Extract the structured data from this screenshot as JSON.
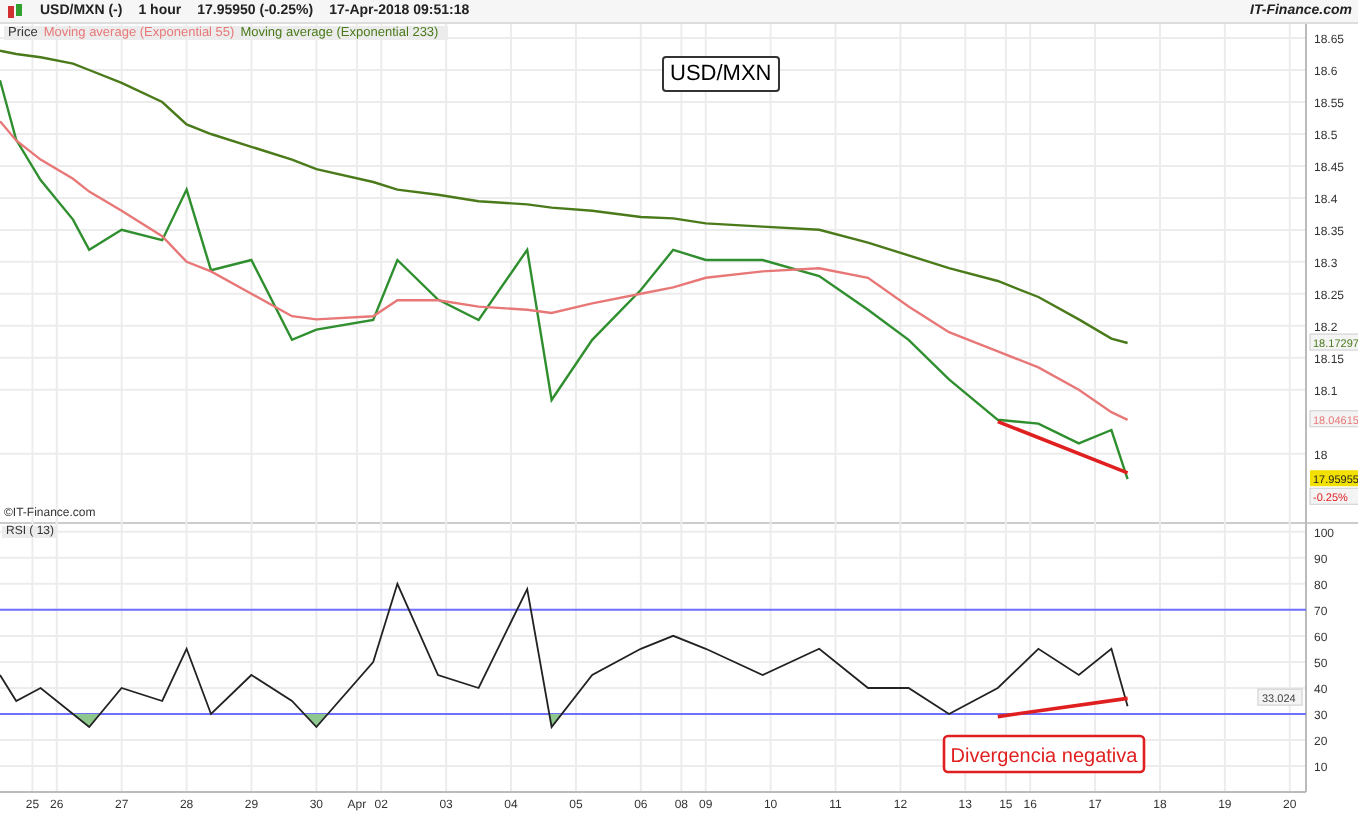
{
  "header": {
    "symbol": "USD/MXN (-)",
    "interval": "1 hour",
    "price": "17.95950 (-0.25%)",
    "datetime": "17-Apr-2018 09:51:18",
    "source": "IT-Finance.com"
  },
  "price_panel": {
    "title": "USD/MXN",
    "copyright": "©IT-Finance.com",
    "chart_data": {
      "type": "line",
      "grid": true,
      "ylim": [
        17.89,
        18.672
      ],
      "yticks": [
        {
          "value": 18,
          "label": "18"
        },
        {
          "value": 18.1,
          "label": "18.1"
        },
        {
          "value": 18.15,
          "label": "18.15"
        },
        {
          "value": 18.2,
          "label": "18.2"
        },
        {
          "value": 18.25,
          "label": "18.25"
        },
        {
          "value": 18.3,
          "label": "18.3"
        },
        {
          "value": 18.35,
          "label": "18.35"
        },
        {
          "value": 18.4,
          "label": "18.4"
        },
        {
          "value": 18.45,
          "label": "18.45"
        },
        {
          "value": 18.5,
          "label": "18.5"
        },
        {
          "value": 18.55,
          "label": "18.55"
        },
        {
          "value": 18.6,
          "label": "18.6"
        },
        {
          "value": 18.65,
          "label": "18.65"
        }
      ],
      "series": [
        {
          "name": "Price",
          "color": "#2f8f2f",
          "values": [
            18.584,
            null,
            18.491,
            null,
            null,
            18.428,
            null,
            null,
            null,
            18.366,
            null,
            18.319,
            null,
            null,
            null,
            18.35,
            null,
            null,
            null,
            null,
            18.334,
            null,
            null,
            18.413,
            null,
            null,
            18.287,
            null,
            null,
            null,
            null,
            18.303,
            null,
            null,
            null,
            null,
            18.178,
            null,
            null,
            18.194,
            null,
            null,
            null,
            null,
            null,
            null,
            18.209,
            null,
            null,
            18.303,
            null,
            null,
            null,
            null,
            18.241,
            null,
            null,
            null,
            null,
            18.209,
            null,
            null,
            null,
            null,
            null,
            18.319,
            null,
            null,
            18.084,
            null,
            null,
            null,
            null,
            18.178,
            null,
            null,
            null,
            null,
            null,
            18.256,
            null,
            null,
            null,
            18.319,
            null,
            null,
            null,
            18.303,
            null,
            null,
            null,
            null,
            null,
            null,
            18.303,
            null,
            null,
            null,
            null,
            null,
            null,
            18.278,
            null,
            null,
            null,
            null,
            null,
            18.225,
            null,
            null,
            null,
            null,
            18.178,
            null,
            null,
            null,
            null,
            18.116,
            null,
            null,
            null,
            null,
            null,
            18.053,
            null,
            null,
            null,
            null,
            18.047,
            null,
            null,
            null,
            null,
            18.016,
            null,
            null,
            null,
            18.037,
            null,
            17.96,
            null,
            null,
            null,
            null,
            null,
            null,
            null,
            null,
            null,
            null,
            null,
            null,
            null,
            null,
            null,
            null,
            null,
            null,
            null,
            null,
            null,
            null
          ]
        },
        {
          "name": "Moving average (Exponential 55)",
          "color": "#e87878",
          "values": [
            18.52,
            null,
            18.49,
            null,
            null,
            18.46,
            null,
            null,
            null,
            18.43,
            null,
            18.41,
            null,
            null,
            null,
            18.38,
            null,
            null,
            null,
            null,
            18.34,
            null,
            null,
            18.3,
            null,
            null,
            18.285,
            null,
            null,
            null,
            null,
            18.25,
            null,
            null,
            null,
            null,
            18.215,
            null,
            null,
            18.21,
            null,
            null,
            null,
            null,
            null,
            null,
            18.215,
            null,
            null,
            18.24,
            null,
            null,
            null,
            null,
            18.24,
            null,
            null,
            null,
            null,
            18.23,
            null,
            null,
            null,
            null,
            null,
            18.225,
            null,
            null,
            18.22,
            null,
            null,
            null,
            null,
            18.235,
            null,
            null,
            null,
            null,
            null,
            18.25,
            null,
            null,
            null,
            18.26,
            null,
            null,
            null,
            18.275,
            null,
            null,
            null,
            null,
            null,
            null,
            18.285,
            null,
            null,
            null,
            null,
            null,
            null,
            18.29,
            null,
            null,
            null,
            null,
            null,
            18.275,
            null,
            null,
            null,
            null,
            18.23,
            null,
            null,
            null,
            null,
            18.19,
            null,
            null,
            null,
            null,
            null,
            18.16,
            null,
            null,
            null,
            null,
            18.135,
            null,
            null,
            null,
            null,
            18.1,
            null,
            null,
            null,
            18.065,
            null,
            18.053,
            null,
            null,
            null,
            null,
            null,
            null,
            null,
            null,
            null,
            null,
            null,
            null,
            null,
            null,
            null,
            null,
            null,
            null,
            null,
            null,
            null,
            null
          ]
        },
        {
          "name": "Moving average (Exponential 233)",
          "color": "#4a7a1a",
          "values": [
            18.63,
            null,
            18.625,
            null,
            null,
            18.62,
            null,
            null,
            null,
            18.61,
            null,
            18.6,
            null,
            null,
            null,
            18.58,
            null,
            null,
            null,
            null,
            18.55,
            null,
            null,
            18.515,
            null,
            null,
            18.5,
            null,
            null,
            null,
            null,
            18.48,
            null,
            null,
            null,
            null,
            18.46,
            null,
            null,
            18.445,
            null,
            null,
            null,
            null,
            null,
            null,
            18.425,
            null,
            null,
            18.413,
            null,
            null,
            null,
            null,
            18.405,
            null,
            null,
            null,
            null,
            18.395,
            null,
            null,
            null,
            null,
            null,
            18.39,
            null,
            null,
            18.385,
            null,
            null,
            null,
            null,
            18.38,
            null,
            null,
            null,
            null,
            null,
            18.37,
            null,
            null,
            null,
            18.368,
            null,
            null,
            null,
            18.36,
            null,
            null,
            null,
            null,
            null,
            null,
            18.355,
            null,
            null,
            null,
            null,
            null,
            null,
            18.35,
            null,
            null,
            null,
            null,
            null,
            18.33,
            null,
            null,
            null,
            null,
            18.31,
            null,
            null,
            null,
            null,
            18.29,
            null,
            null,
            null,
            null,
            null,
            18.27,
            null,
            null,
            null,
            null,
            18.245,
            null,
            null,
            null,
            null,
            18.21,
            null,
            null,
            null,
            18.18,
            null,
            18.173,
            null,
            null,
            null,
            null,
            null,
            null,
            null,
            null,
            null,
            null,
            null,
            null,
            null,
            null,
            null,
            null,
            null,
            null,
            null,
            null,
            null,
            null
          ]
        },
        {
          "color": "#e02020",
          "values": [
            null,
            null,
            null,
            null,
            null,
            null,
            null,
            null,
            null,
            null,
            null,
            null,
            null,
            null,
            null,
            null,
            null,
            null,
            null,
            null,
            null,
            null,
            null,
            null,
            null,
            null,
            null,
            null,
            null,
            null,
            null,
            null,
            null,
            null,
            null,
            null,
            null,
            null,
            null,
            null,
            null,
            null,
            null,
            null,
            null,
            null,
            null,
            null,
            null,
            null,
            null,
            null,
            null,
            null,
            null,
            null,
            null,
            null,
            null,
            null,
            null,
            null,
            null,
            null,
            null,
            null,
            null,
            null,
            null,
            null,
            null,
            null,
            null,
            null,
            null,
            null,
            null,
            null,
            null,
            null,
            null,
            null,
            null,
            null,
            null,
            null,
            null,
            null,
            null,
            null,
            null,
            null,
            null,
            null,
            null,
            null,
            null,
            null,
            null,
            null,
            null,
            null,
            null,
            null,
            null,
            null,
            null,
            null,
            null,
            null,
            null,
            null,
            null,
            null,
            null,
            null,
            null,
            null,
            null,
            null,
            null,
            null,
            null,
            18.05,
            null,
            null,
            null,
            null,
            null,
            null,
            null,
            null,
            null,
            null,
            null,
            null,
            null,
            null,
            null,
            17.97,
            null,
            null,
            null,
            null,
            null,
            null,
            null,
            null,
            null,
            null,
            null,
            null,
            null,
            null,
            null,
            null,
            null,
            null,
            null,
            null,
            null,
            null
          ]
        }
      ]
    },
    "value_tags": [
      {
        "text": "18.17297",
        "kind": "long_average"
      },
      {
        "text": "18.04615",
        "kind": "short_average"
      },
      {
        "text": "17.95955",
        "kind": "last"
      },
      {
        "text": "-0.25%",
        "kind": "change"
      }
    ]
  },
  "rsi_panel": {
    "chart_data": {
      "type": "line",
      "grid": true,
      "ylim": [
        0,
        103
      ],
      "categories": [
        null,
        null,
        null,
        null,
        "25",
        null,
        null,
        "26",
        null,
        null,
        null,
        null,
        null,
        null,
        null,
        "27",
        null,
        null,
        null,
        null,
        null,
        null,
        null,
        "28",
        null,
        null,
        null,
        null,
        null,
        null,
        null,
        "29",
        null,
        null,
        null,
        null,
        null,
        null,
        null,
        "30",
        null,
        null,
        null,
        null,
        "Apr",
        null,
        null,
        "02",
        null,
        null,
        null,
        null,
        null,
        null,
        null,
        "03",
        null,
        null,
        null,
        null,
        null,
        null,
        null,
        "04",
        null,
        null,
        null,
        null,
        null,
        null,
        null,
        "05",
        null,
        null,
        null,
        null,
        null,
        null,
        null,
        "06",
        null,
        null,
        null,
        null,
        "08",
        null,
        null,
        "09",
        null,
        null,
        null,
        null,
        null,
        null,
        null,
        "10",
        null,
        null,
        null,
        null,
        null,
        null,
        null,
        "11",
        null,
        null,
        null,
        null,
        null,
        null,
        null,
        "12",
        null,
        null,
        null,
        null,
        null,
        null,
        null,
        "13",
        null,
        null,
        null,
        null,
        "15",
        null,
        null,
        "16",
        null,
        null,
        null,
        null,
        null,
        null,
        null,
        "17",
        null,
        null,
        null,
        null,
        null,
        null,
        null,
        "18",
        null,
        null,
        null,
        null,
        null,
        null,
        null,
        "19",
        null,
        null,
        null,
        null,
        null,
        null,
        null,
        "20",
        null,
        null
      ],
      "yticks": [
        10,
        20,
        30,
        40,
        50,
        60,
        70,
        80,
        90,
        100
      ],
      "series": [
        {
          "name": "RSI ( 13)",
          "color": "#222222",
          "values": [
            45,
            null,
            35,
            null,
            null,
            40,
            null,
            null,
            null,
            30,
            null,
            25,
            null,
            null,
            null,
            40,
            null,
            null,
            null,
            null,
            35,
            null,
            null,
            55,
            null,
            null,
            30,
            null,
            null,
            null,
            null,
            45,
            null,
            null,
            null,
            null,
            35,
            null,
            null,
            25,
            null,
            null,
            null,
            null,
            null,
            null,
            50,
            null,
            null,
            80,
            null,
            null,
            null,
            null,
            45,
            null,
            null,
            null,
            null,
            40,
            null,
            null,
            null,
            null,
            null,
            78,
            null,
            null,
            25,
            null,
            null,
            null,
            null,
            45,
            null,
            null,
            null,
            null,
            null,
            55,
            null,
            null,
            null,
            60,
            null,
            null,
            null,
            55,
            null,
            null,
            null,
            null,
            null,
            null,
            45,
            null,
            null,
            null,
            null,
            null,
            null,
            55,
            null,
            null,
            null,
            null,
            null,
            40,
            null,
            null,
            null,
            null,
            40,
            null,
            null,
            null,
            null,
            30,
            null,
            null,
            null,
            null,
            null,
            40,
            null,
            null,
            null,
            null,
            55,
            null,
            null,
            null,
            null,
            45,
            null,
            null,
            null,
            55,
            null,
            33,
            null,
            null,
            null,
            null,
            null,
            null,
            null,
            null,
            null,
            null,
            null,
            null,
            null,
            null,
            null,
            null,
            null,
            null,
            null,
            null,
            null,
            null
          ]
        },
        {
          "color": "#e02020",
          "values": [
            null,
            null,
            null,
            null,
            null,
            null,
            null,
            null,
            null,
            null,
            null,
            null,
            null,
            null,
            null,
            null,
            null,
            null,
            null,
            null,
            null,
            null,
            null,
            null,
            null,
            null,
            null,
            null,
            null,
            null,
            null,
            null,
            null,
            null,
            null,
            null,
            null,
            null,
            null,
            null,
            null,
            null,
            null,
            null,
            null,
            null,
            null,
            null,
            null,
            null,
            null,
            null,
            null,
            null,
            null,
            null,
            null,
            null,
            null,
            null,
            null,
            null,
            null,
            null,
            null,
            null,
            null,
            null,
            null,
            null,
            null,
            null,
            null,
            null,
            null,
            null,
            null,
            null,
            null,
            null,
            null,
            null,
            null,
            null,
            null,
            null,
            null,
            null,
            null,
            null,
            null,
            null,
            null,
            null,
            null,
            null,
            null,
            null,
            null,
            null,
            null,
            null,
            null,
            null,
            null,
            null,
            null,
            null,
            null,
            null,
            null,
            null,
            null,
            null,
            null,
            null,
            null,
            null,
            null,
            null,
            null,
            null,
            null,
            29,
            null,
            null,
            null,
            null,
            null,
            null,
            null,
            null,
            null,
            null,
            null,
            null,
            null,
            null,
            null,
            36,
            null,
            null,
            null,
            null,
            null,
            null,
            null,
            null,
            null,
            null,
            null,
            null,
            null,
            null,
            null,
            null,
            null,
            null,
            null,
            null,
            null,
            null
          ]
        }
      ],
      "annotations": [
        "Divergencia negativa"
      ]
    },
    "value_tags": [
      {
        "text": "33.024",
        "kind": "last"
      }
    ]
  }
}
